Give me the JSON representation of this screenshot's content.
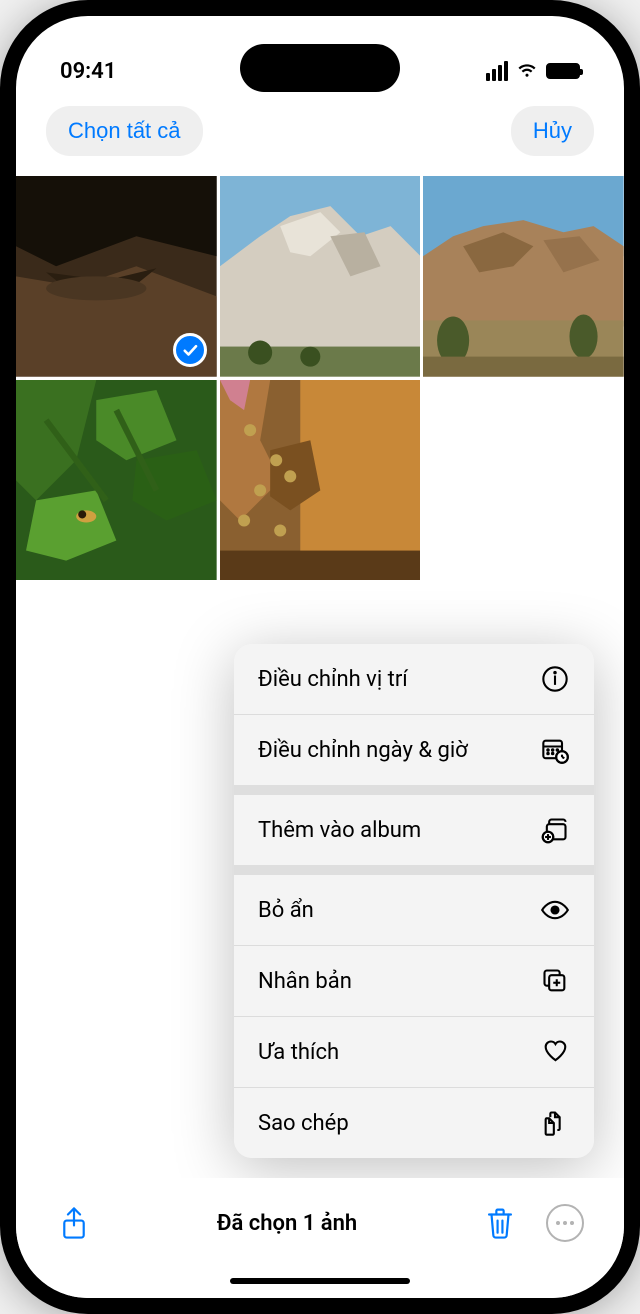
{
  "statusBar": {
    "time": "09:41"
  },
  "nav": {
    "selectAll": "Chọn tất cả",
    "cancel": "Hủy"
  },
  "grid": {
    "items": [
      {
        "name": "lizard-rock",
        "selected": true
      },
      {
        "name": "rock-formation",
        "selected": false
      },
      {
        "name": "desert-rocks",
        "selected": false
      },
      {
        "name": "bee-on-plant",
        "selected": false
      },
      {
        "name": "beehive-wall",
        "selected": false
      }
    ]
  },
  "menu": {
    "items": [
      {
        "label": "Điều chỉnh vị trí",
        "icon": "info-circle-icon"
      },
      {
        "label": "Điều chỉnh ngày & giờ",
        "icon": "calendar-clock-icon"
      },
      {
        "label": "Thêm vào album",
        "icon": "album-add-icon"
      },
      {
        "label": "Bỏ ẩn",
        "icon": "eye-icon"
      },
      {
        "label": "Nhân bản",
        "icon": "duplicate-icon"
      },
      {
        "label": "Ưa thích",
        "icon": "heart-icon"
      },
      {
        "label": "Sao chép",
        "icon": "copy-icon"
      }
    ]
  },
  "bottomBar": {
    "selectionText": "Đã chọn 1 ảnh"
  }
}
